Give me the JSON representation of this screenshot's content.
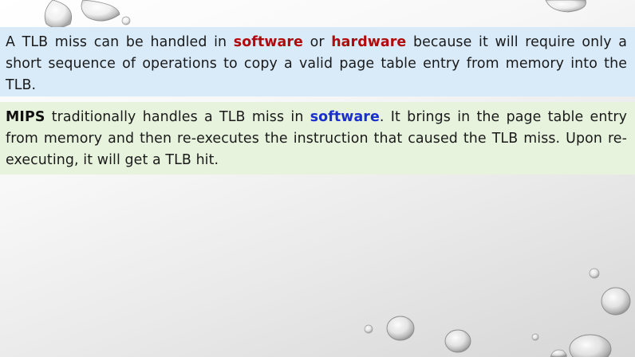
{
  "paragraph1": {
    "part1": "A TLB miss can be handled in ",
    "software": "software",
    "part2": " or ",
    "hardware": "hardware",
    "part3": " because it will require only a short sequence of operations to copy a valid page table entry from memory into the TLB."
  },
  "paragraph2": {
    "mips": "MIPS",
    "part1": " traditionally handles a TLB miss in ",
    "software": "software",
    "part2": ". It brings in the page table entry from memory and then re-executes the instruction that caused the TLB miss. Upon re-executing, it will get a TLB hit."
  },
  "colors": {
    "box1_bg": "#d9ebf9",
    "box2_bg": "#e7f3dd",
    "emphasis_red": "#b20a0a",
    "emphasis_blue": "#1a2fd0"
  }
}
